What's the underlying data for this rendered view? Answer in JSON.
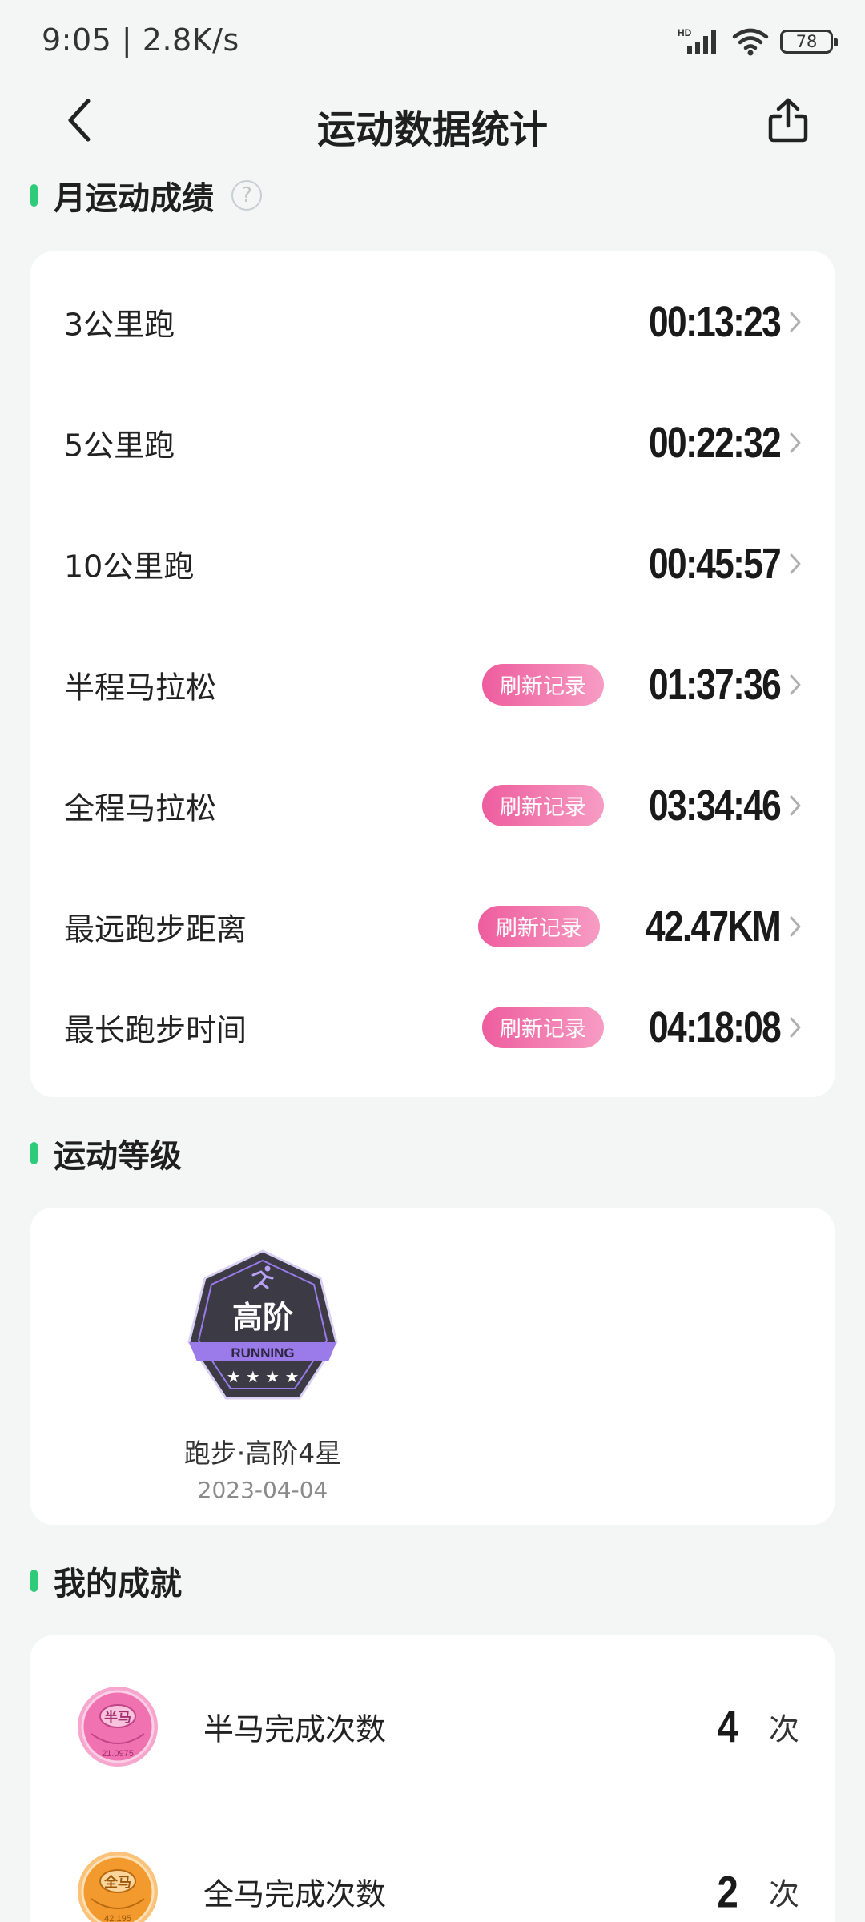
{
  "status_bar": {
    "time": "9:05 | 2.8K/s",
    "network_label": "HD",
    "battery": "78"
  },
  "nav": {
    "title": "运动数据统计"
  },
  "monthly": {
    "title": "月运动成绩",
    "help_symbol": "?",
    "records": [
      {
        "label": "3公里跑",
        "value": "00:13:23",
        "badge": ""
      },
      {
        "label": "5公里跑",
        "value": "00:22:32",
        "badge": ""
      },
      {
        "label": "10公里跑",
        "value": "00:45:57",
        "badge": ""
      },
      {
        "label": "半程马拉松",
        "value": "01:37:36",
        "badge": "刷新记录"
      },
      {
        "label": "全程马拉松",
        "value": "03:34:46",
        "badge": "刷新记录"
      },
      {
        "label": "最远跑步距离",
        "value": "42.47KM",
        "badge": "刷新记录"
      },
      {
        "label": "最长跑步时间",
        "value": "04:18:08",
        "badge": "刷新记录"
      }
    ]
  },
  "level": {
    "title": "运动等级",
    "badge_text": "高阶",
    "badge_sub": "RUNNING",
    "name": "跑步·高阶4星",
    "date": "2023-04-04"
  },
  "achievements": {
    "title": "我的成就",
    "items": [
      {
        "label": "半马完成次数",
        "count": "4",
        "unit": "次",
        "medal_text": "半马",
        "medal_sub": "21.0975"
      },
      {
        "label": "全马完成次数",
        "count": "2",
        "unit": "次",
        "medal_text": "全马",
        "medal_sub": "42.195"
      }
    ]
  },
  "colors": {
    "accent_green": "#2ecb7b",
    "badge_pink": "#ee5d9e",
    "level_purple": "#9b7bea",
    "level_dark": "#3b3a45"
  }
}
